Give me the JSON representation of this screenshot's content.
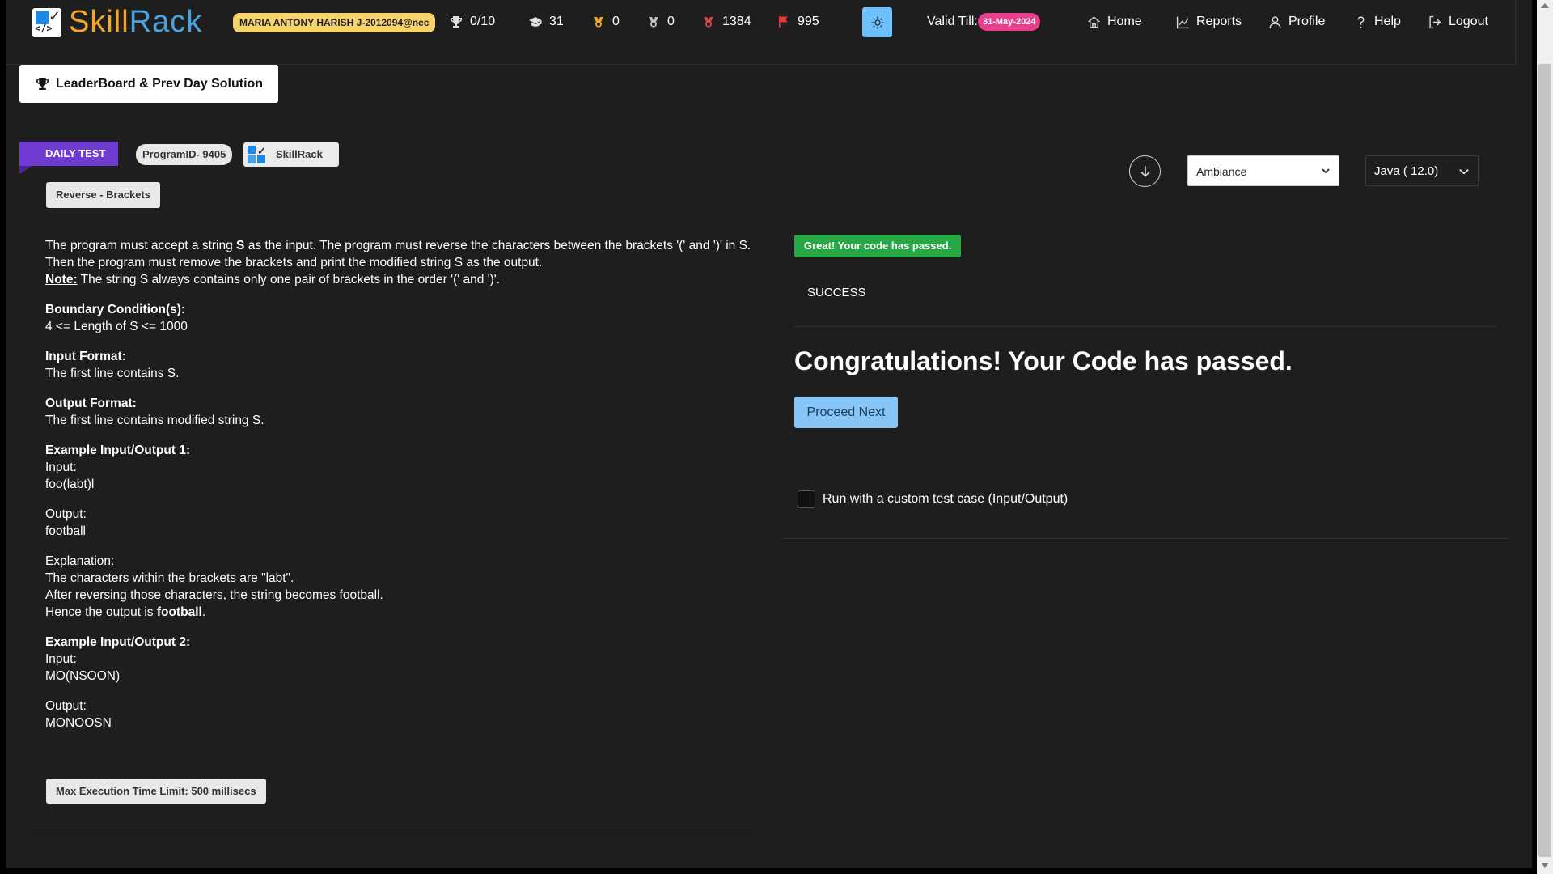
{
  "header": {
    "logo": {
      "part1": "Skill",
      "part2": "Rack",
      "box_code": "</>"
    },
    "user": "MARIA ANTONY HARISH J-2012094@nec",
    "stats": [
      {
        "icon": "trophy-icon",
        "value": "0/10"
      },
      {
        "icon": "graduation-cap-icon",
        "value": "31"
      },
      {
        "icon": "gold-badge-icon",
        "value": "0"
      },
      {
        "icon": "silver-badge-icon",
        "value": "0"
      },
      {
        "icon": "red-badge-icon",
        "value": "1384"
      },
      {
        "icon": "flag-icon",
        "value": "995"
      }
    ],
    "valid_label": "Valid Till:",
    "valid_date": "31-May-2024",
    "nav": [
      {
        "icon": "home-icon",
        "label": "Home"
      },
      {
        "icon": "reports-icon",
        "label": "Reports"
      },
      {
        "icon": "profile-icon",
        "label": "Profile"
      },
      {
        "icon": "help-icon",
        "label": "Help"
      },
      {
        "icon": "logout-icon",
        "label": "Logout"
      }
    ]
  },
  "leaderboard_button": "LeaderBoard & Prev Day Solution",
  "tags": {
    "daily": "DAILY TEST",
    "program_id": "ProgramID- 9405",
    "skillrack": "SkillRack",
    "title": "Reverse - Brackets",
    "exec_limit": "Max Execution Time Limit: 500 millisecs"
  },
  "problem": {
    "desc_a": "The program must accept a string ",
    "desc_b": "S",
    "desc_c": " as the input. The program must reverse the characters between the brackets '(' and ')' in S. Then the program must remove the brackets and print the modified string S as the output.",
    "note_label": "Note:",
    "note_text": " The string S always contains only one pair of brackets in the order '(' and ')'.",
    "boundary_title": "Boundary Condition(s):",
    "boundary_text": "4 <= Length of S <= 1000",
    "input_format_title": "Input Format:",
    "input_format_text": "The first line contains S.",
    "output_format_title": "Output Format:",
    "output_format_text": "The first line contains modified string S.",
    "ex1_title": "Example Input/Output 1:",
    "ex1_input_label": "Input:",
    "ex1_input": "foo(labt)l",
    "ex1_output_label": "Output:",
    "ex1_output": "football",
    "explanation_label": "Explanation:",
    "explanation_line1": "The characters within the brackets are \"labt\".",
    "explanation_line2": "After reversing those characters, the string becomes football.",
    "explanation_line3a": "Hence the output is ",
    "explanation_line3b": "football",
    "explanation_line3c": ".",
    "ex2_title": "Example Input/Output 2:",
    "ex2_input_label": "Input:",
    "ex2_input": "MO(NSOON)",
    "ex2_output_label": "Output:",
    "ex2_output": "MONOOSN"
  },
  "editor": {
    "theme_selected": "Ambiance",
    "language_selected": "Java ( 12.0)"
  },
  "result": {
    "badge": "Great! Your code has passed.",
    "status": "SUCCESS",
    "congrats": "Congratulations! Your Code has passed.",
    "proceed": "Proceed Next",
    "custom_test": "Run with a custom test case (Input/Output)"
  },
  "colors": {
    "background": "#1e1e1e",
    "user_badge": "#f7d36b",
    "daily_tag": "#6f3bd1",
    "valid_pill": "#e83e8c",
    "passed": "#28a745",
    "proceed": "#86c5f5",
    "theme_button": "#6ec1ff"
  }
}
